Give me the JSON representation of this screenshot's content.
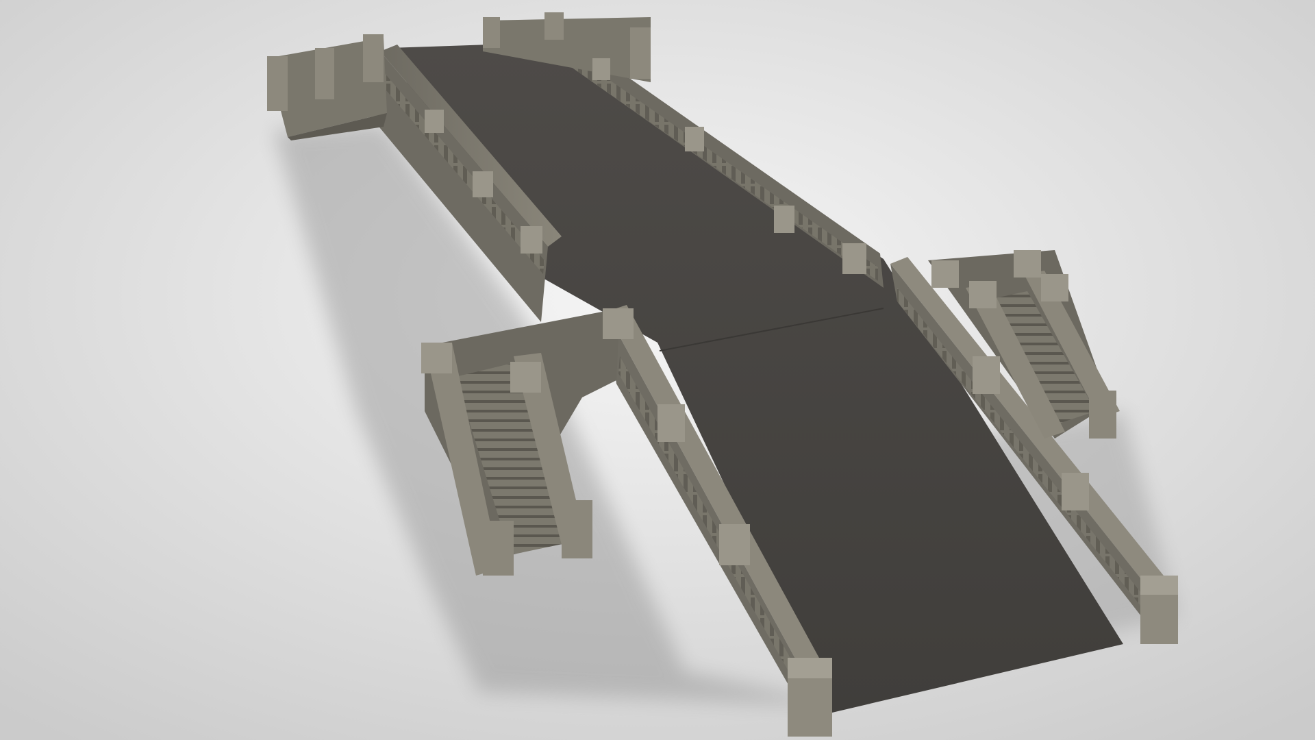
{
  "scene": {
    "subject": "stone-pedestrian-bridge-3d-render",
    "colors": {
      "backdrop_light": "#f4f4f4",
      "backdrop_dark": "#cfcfcf",
      "deck": "#4a4744",
      "deck_dark": "#3b3936",
      "stone": "#7e7b70",
      "stone_light": "#9a968a",
      "stone_dark": "#5f5c54",
      "shadow": "#8c8c8c"
    }
  }
}
